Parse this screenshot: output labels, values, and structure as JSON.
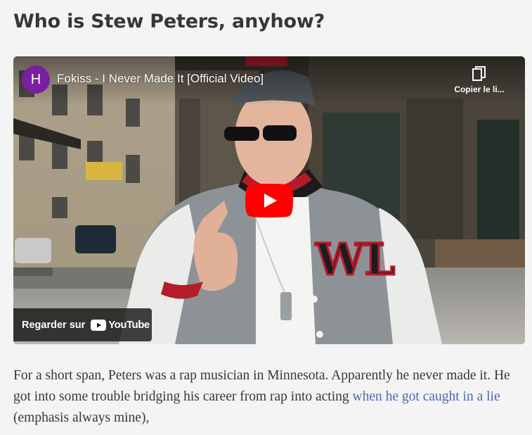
{
  "article": {
    "heading": "Who is Stew Peters, anyhow?",
    "paragraph": {
      "text_before_link": "For a short span, Peters was a rap musician in Minnesota. Apparently he never made it. He got into some trouble bridging his career from rap into acting ",
      "link_text": "when he got caught in a lie",
      "text_after_link": " (emphasis always mine),"
    }
  },
  "video_embed": {
    "channel_avatar_letter": "H",
    "title": "Fokiss - I Never Made It [Official Video]",
    "copy_link_label": "Copier le li...",
    "watch_on_label": "Regarder sur",
    "youtube_wordmark": "YouTube",
    "jacket_letters": "WL",
    "colors": {
      "avatar": "#7b1fa2",
      "play_button": "#ff0000",
      "link": "#4a68b8"
    },
    "icons": {
      "copy": "copy-icon",
      "play": "play-icon",
      "youtube": "youtube-logo-icon"
    }
  }
}
